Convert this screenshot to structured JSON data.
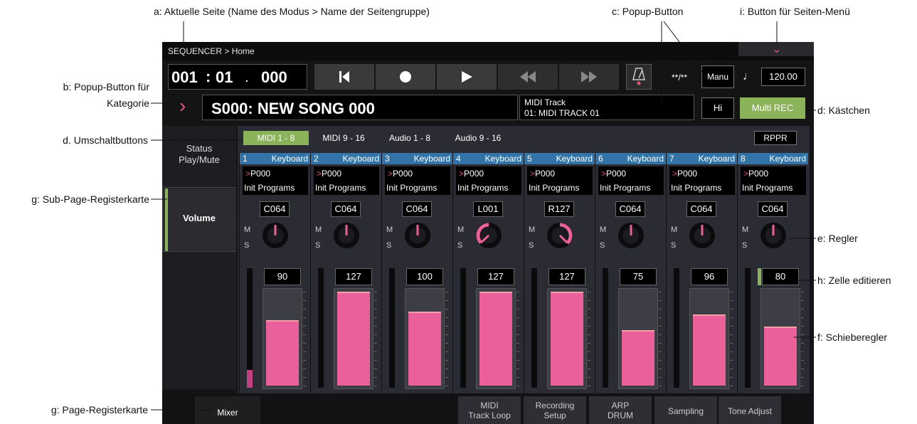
{
  "annotations": {
    "a": "a: Aktuelle Seite (Name des Modus > Name der Seitengruppe)",
    "b1": "b: Popup-Button für",
    "b2": "Kategorie",
    "c": "c: Popup-Button",
    "i": "i: Button für Seiten-Menü",
    "d_box": "d: Kästchen",
    "d_toggle": "d. Umschaltbuttons",
    "g_sub": "g: Sub-Page-Registerkarte",
    "e": "e: Regler",
    "h": "h: Zelle editieren",
    "f": "f: Schieberegler",
    "g_page": "g: Page-Registerkarte"
  },
  "header": {
    "title": "SEQUENCER > Home",
    "menu_icon": "chevron-down-icon"
  },
  "locator": {
    "measure": "001",
    "sep1": ":",
    "beat": "01",
    "sep2": ".",
    "tick": "000"
  },
  "transport": {
    "to_start": "K",
    "record": "●",
    "play": "▶",
    "rewind": "◀◀",
    "forward": "▶▶"
  },
  "time_signature": "**/**",
  "tempo_mode": "Manu",
  "tempo_note": "♩",
  "tempo": "120.00",
  "song": {
    "chevron": "›",
    "name": "S000: NEW SONG 000"
  },
  "track": {
    "line1": "MIDI Track",
    "line2": "01: MIDI TRACK 01"
  },
  "hi_button": "Hi",
  "multi_rec": "Multi REC",
  "track_toggles": [
    "MIDI 1 - 8",
    "MIDI 9 - 16",
    "Audio 1 - 8",
    "Audio 9 - 16"
  ],
  "rppr": "RPPR",
  "subtabs": {
    "status": "Status Play/Mute",
    "volume": "Volume"
  },
  "channels": [
    {
      "num": "1",
      "type": "Keyboard",
      "prog_prefix": ">",
      "prog": "P000",
      "bank": "Init Programs",
      "pan": "C064",
      "m": "M",
      "s": "S",
      "volume": "90",
      "level": 0.7,
      "meter": 0.15
    },
    {
      "num": "2",
      "type": "Keyboard",
      "prog_prefix": ">",
      "prog": "P000",
      "bank": "Init Programs",
      "pan": "C064",
      "m": "M",
      "s": "S",
      "volume": "127",
      "level": 1.0,
      "meter": 0
    },
    {
      "num": "3",
      "type": "Keyboard",
      "prog_prefix": ">",
      "prog": "P000",
      "bank": "Init Programs",
      "pan": "C064",
      "m": "M",
      "s": "S",
      "volume": "100",
      "level": 0.79,
      "meter": 0
    },
    {
      "num": "4",
      "type": "Keyboard",
      "prog_prefix": ">",
      "prog": "P000",
      "bank": "Init Programs",
      "pan": "L001",
      "m": "M",
      "s": "S",
      "volume": "127",
      "level": 1.0,
      "meter": 0
    },
    {
      "num": "5",
      "type": "Keyboard",
      "prog_prefix": ">",
      "prog": "P000",
      "bank": "Init Programs",
      "pan": "R127",
      "m": "M",
      "s": "S",
      "volume": "127",
      "level": 1.0,
      "meter": 0
    },
    {
      "num": "6",
      "type": "Keyboard",
      "prog_prefix": ">",
      "prog": "P000",
      "bank": "Init Programs",
      "pan": "C064",
      "m": "M",
      "s": "S",
      "volume": "75",
      "level": 0.59,
      "meter": 0
    },
    {
      "num": "7",
      "type": "Keyboard",
      "prog_prefix": ">",
      "prog": "P000",
      "bank": "Init Programs",
      "pan": "C064",
      "m": "M",
      "s": "S",
      "volume": "96",
      "level": 0.76,
      "meter": 0
    },
    {
      "num": "8",
      "type": "Keyboard",
      "prog_prefix": ">",
      "prog": "P000",
      "bank": "Init Programs",
      "pan": "C064",
      "m": "M",
      "s": "S",
      "volume": "80",
      "level": 0.63,
      "meter": 0
    }
  ],
  "pagetabs": [
    {
      "line1": "Mixer",
      "line2": ""
    },
    {
      "line1": "MIDI",
      "line2": "Track Loop"
    },
    {
      "line1": "Recording",
      "line2": "Setup"
    },
    {
      "line1": "ARP",
      "line2": "DRUM"
    },
    {
      "line1": "Sampling",
      "line2": ""
    },
    {
      "line1": "Tone Adjust",
      "line2": ""
    }
  ],
  "colors": {
    "accent_green": "#8ab35a",
    "fader_pink": "#e9609a",
    "track_blue": "#3274a8",
    "chevron_pink": "#e05a78"
  }
}
